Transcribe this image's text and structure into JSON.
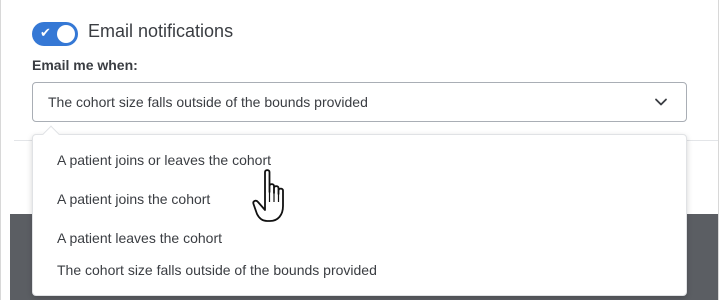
{
  "notifications": {
    "toggle_label": "Email notifications",
    "toggle_on": true,
    "field_label": "Email me when:",
    "selected_value": "The cohort size falls outside of the bounds provided",
    "options": [
      "A patient joins or leaves the cohort",
      "A patient joins the cohort",
      "A patient leaves the cohort",
      "The cohort size falls outside of the bounds provided"
    ]
  },
  "icons": {
    "toggle_check": "check-icon",
    "select_chevron": "chevron-down-icon",
    "cursor": "hand-pointer-icon"
  },
  "colors": {
    "accent": "#3578d5",
    "text": "#3a3d42",
    "backdrop": "#5b5e63"
  }
}
